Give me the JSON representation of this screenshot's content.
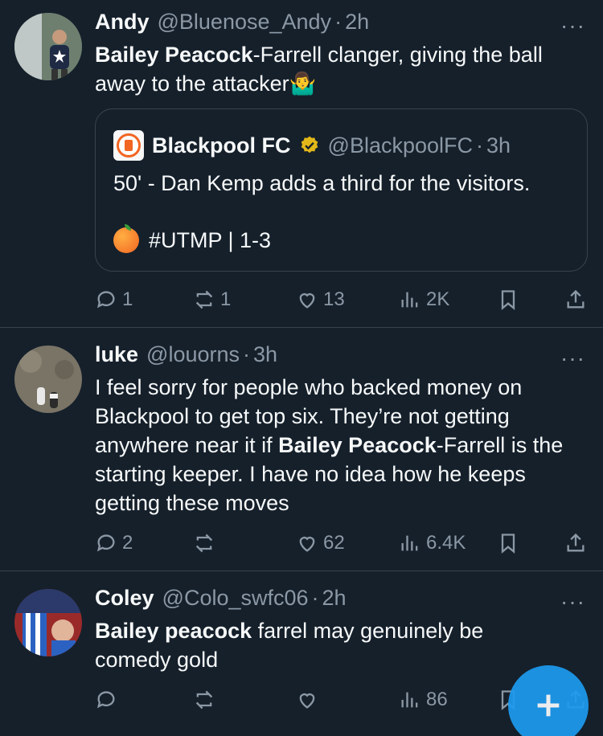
{
  "tweets": [
    {
      "name": "Andy",
      "handle": "@Bluenose_Andy",
      "dot": "·",
      "time": "2h",
      "more": "···",
      "text_bold": "Bailey Peacock",
      "text_rest": "-Farrell clanger, giving the ball away to the attacker",
      "emoji": "🤷‍♂️",
      "quote": {
        "name": "Blackpool FC",
        "handle": "@BlackpoolFC",
        "dot": "·",
        "time": "3h",
        "line1": "50' - Dan Kemp adds a third for the visitors.",
        "line2": "#UTMP | 1-3"
      },
      "actions": {
        "replies": "1",
        "retweets": "1",
        "likes": "13",
        "views": "2K"
      }
    },
    {
      "name": "luke",
      "handle": "@louorns",
      "dot": "·",
      "time": "3h",
      "more": "···",
      "text_pre": "I feel sorry for people who backed money on Blackpool to get top six. They’re not getting anywhere near it if ",
      "text_bold": "Bailey Peacock",
      "text_post": "-Farrell is the starting keeper. I have no idea how he keeps getting these moves",
      "actions": {
        "replies": "2",
        "retweets": "",
        "likes": "62",
        "views": "6.4K"
      }
    },
    {
      "name": "Coley",
      "handle": "@Colo_swfc06",
      "dot": "·",
      "time": "2h",
      "more": "···",
      "text_bold": "Bailey peacock",
      "text_rest": " farrel may genuinely be comedy gold",
      "actions": {
        "replies": "",
        "retweets": "",
        "likes": "",
        "views": "86"
      }
    }
  ],
  "icons": {
    "reply": "reply-icon",
    "retweet": "retweet-icon",
    "like": "heart-icon",
    "views": "views-icon",
    "bookmark": "bookmark-icon",
    "share": "share-icon",
    "compose": "compose-plus-icon"
  },
  "colors": {
    "background": "#15202b",
    "secondary_text": "#8b98a5",
    "divider": "#38444d",
    "accent": "#1d9bf0",
    "verified_gold": "#e2b719"
  }
}
